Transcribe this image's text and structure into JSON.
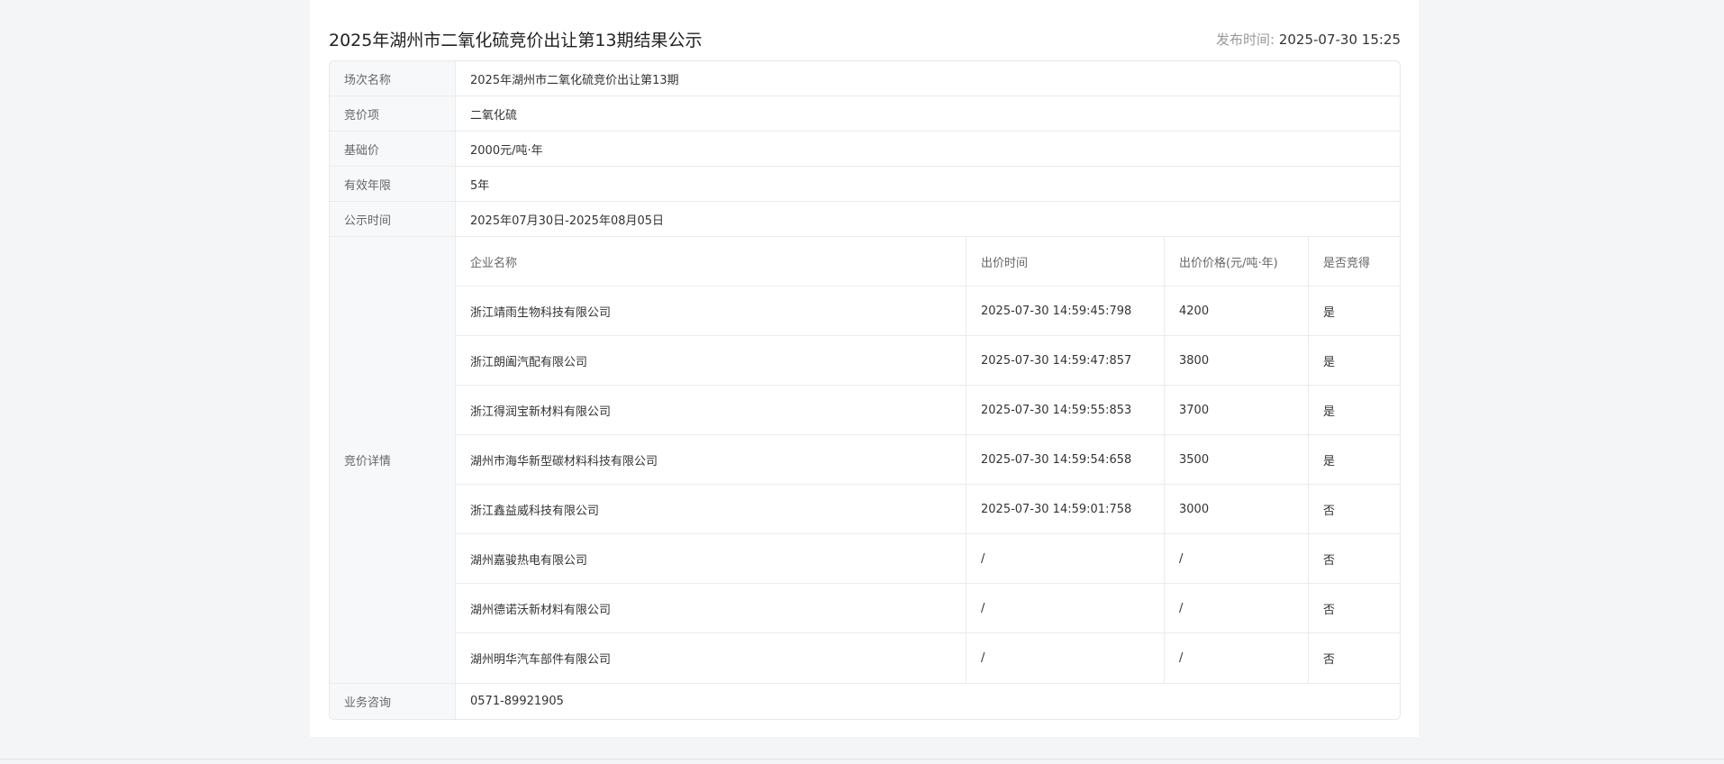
{
  "header": {
    "title": "2025年湖州市二氧化硫竞价出让第13期结果公示",
    "pub_label": "发布时间: ",
    "pub_value": "2025-07-30 15:25"
  },
  "info": {
    "session": {
      "label": "场次名称",
      "value": "2025年湖州市二氧化硫竞价出让第13期"
    },
    "item": {
      "label": "竞价项",
      "value": "二氧化硫"
    },
    "base_price": {
      "label": "基础价",
      "value": "2000元/吨·年"
    },
    "valid_years": {
      "label": "有效年限",
      "value": "5年"
    },
    "publicity": {
      "label": "公示时间",
      "value": "2025年07月30日-2025年08月05日"
    },
    "detail_label": "竞价详情",
    "contact": {
      "label": "业务咨询",
      "value": "0571-89921905"
    }
  },
  "bid_table": {
    "headers": [
      "企业名称",
      "出价时间",
      "出价价格(元/吨·年)",
      "是否竞得"
    ],
    "rows": [
      [
        "浙江靖雨生物科技有限公司",
        "2025-07-30 14:59:45:798",
        "4200",
        "是"
      ],
      [
        "浙江朗阖汽配有限公司",
        "2025-07-30 14:59:47:857",
        "3800",
        "是"
      ],
      [
        "浙江得润宝新材料有限公司",
        "2025-07-30 14:59:55:853",
        "3700",
        "是"
      ],
      [
        "湖州市海华新型碳材料科技有限公司",
        "2025-07-30 14:59:54:658",
        "3500",
        "是"
      ],
      [
        "浙江鑫益威科技有限公司",
        "2025-07-30 14:59:01:758",
        "3000",
        "否"
      ],
      [
        "湖州嘉骏热电有限公司",
        "/",
        "/",
        "否"
      ],
      [
        "湖州德诺沃新材料有限公司",
        "/",
        "/",
        "否"
      ],
      [
        "湖州明华汽车部件有限公司",
        "/",
        "/",
        "否"
      ]
    ]
  }
}
